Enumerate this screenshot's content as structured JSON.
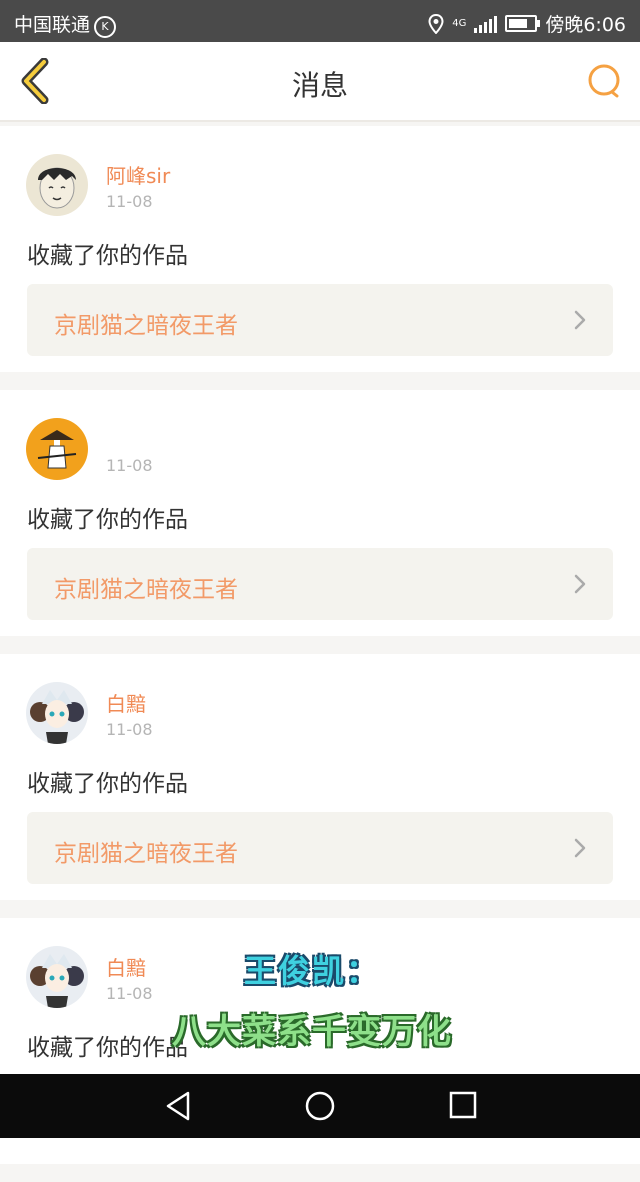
{
  "status_bar": {
    "carrier": "中国联通",
    "k_badge": "K",
    "network": "4G",
    "time": "傍晚6:06"
  },
  "header": {
    "title": "消息",
    "back_icon": "back-chevron-icon",
    "search_icon": "search-icon"
  },
  "notifications": [
    {
      "user": "阿峰sir",
      "date": "11-08",
      "message": "收藏了你的作品",
      "work_title": "京剧猫之暗夜王者"
    },
    {
      "user": "",
      "date": "11-08",
      "message": "收藏了你的作品",
      "work_title": "京剧猫之暗夜王者"
    },
    {
      "user": "白黯",
      "date": "11-08",
      "message": "收藏了你的作品",
      "work_title": "京剧猫之暗夜王者"
    },
    {
      "user": "白黯",
      "date": "11-08",
      "message": "收藏了你的作品",
      "work_title": ""
    }
  ],
  "overlay": {
    "line1": "王俊凯：",
    "line2": "八大菜系千变万化"
  },
  "colors": {
    "accent": "#f08a55",
    "work_bg": "#f4f3ee",
    "statusbar": "#4a4a4a",
    "navbar": "#0b0b0b"
  }
}
